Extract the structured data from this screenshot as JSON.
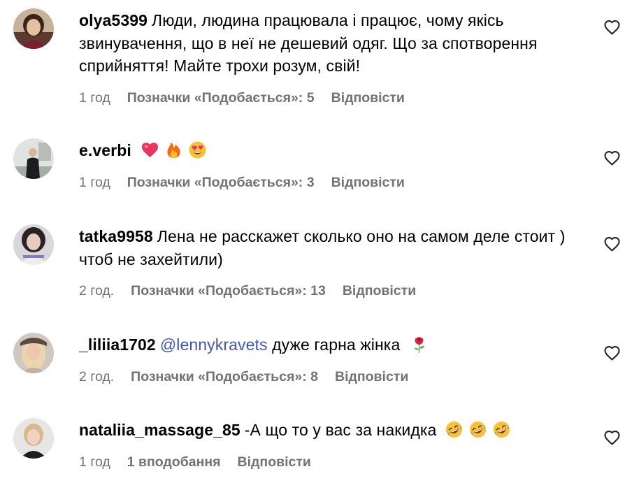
{
  "comments": [
    {
      "username": "olya5399",
      "text": "Люди, людина працювала і працює, чому якісь звинувачення, що в неї не дешевий одяг. Що за спотворення сприйняття! Майте трохи розум, свій!",
      "time": "1 год",
      "likes": "Позначки «Подобається»: 5",
      "reply": "Відповісти"
    },
    {
      "username": "e.verbi",
      "text": "",
      "emojis": [
        "heart-emoji",
        "fire-emoji",
        "heart-eyes-emoji"
      ],
      "time": "1 год",
      "likes": "Позначки «Подобається»: 3",
      "reply": "Відповісти"
    },
    {
      "username": "tatka9958",
      "text": "Лена не расскажет сколько оно на самом деле стоит ) чтоб не захейтили)",
      "time": "2 год.",
      "likes": "Позначки «Подобається»: 13",
      "reply": "Відповісти"
    },
    {
      "username": "_liliia1702",
      "mention": "@lennykravets",
      "text": "дуже гарна жінка",
      "emojis": [
        "rose-emoji"
      ],
      "time": "2 год.",
      "likes": "Позначки «Подобається»: 8",
      "reply": "Відповісти"
    },
    {
      "username": "nataliia_massage_85",
      "text": "-А що то у вас за накидка",
      "emojis": [
        "rofl-emoji",
        "rofl-emoji",
        "rofl-emoji"
      ],
      "time": "1 год",
      "likes": "1 вподобання",
      "reply": "Відповісти"
    }
  ],
  "colors": {
    "meta_text": "#737373",
    "mention": "#4458a8",
    "heart_outline": "#262626"
  },
  "icons": {
    "like": "heart-outline-icon"
  }
}
